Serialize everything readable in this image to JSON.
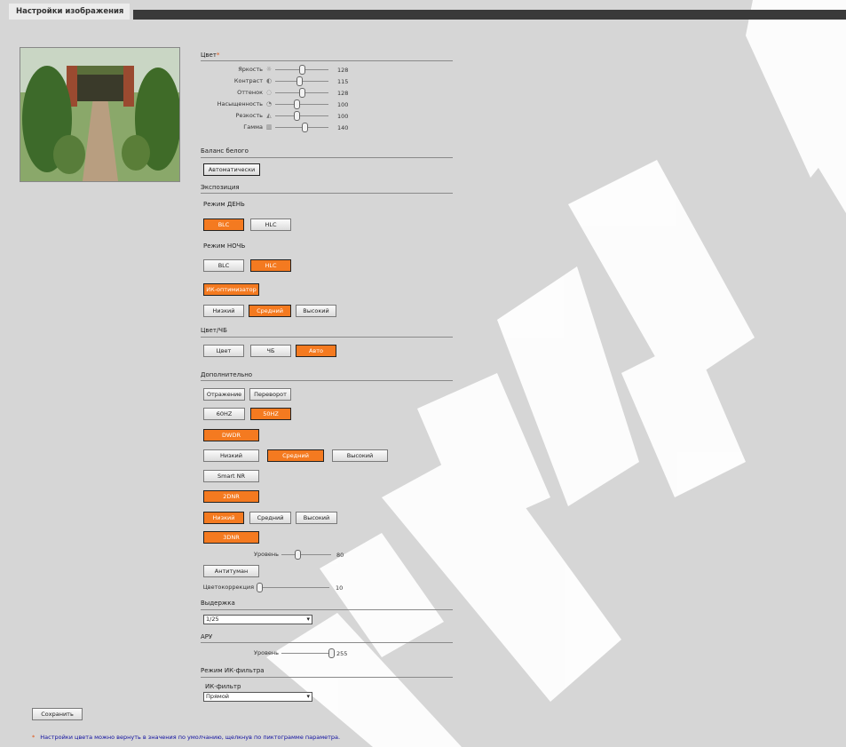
{
  "header": {
    "tab_title": "Настройки изображения"
  },
  "sections": {
    "color": "Цвет",
    "color_star": "*",
    "white_balance": "Баланс белого",
    "exposure": "Экспозиция",
    "color_bw": "Цвет/ЧБ",
    "additional": "Дополнительно",
    "shutter": "Выдержка",
    "agc": "АРУ",
    "ir_filter_mode": "Режим ИК-фильтра"
  },
  "sliders": {
    "brightness": {
      "label": "Яркость",
      "value": "128",
      "icon": "sun-icon",
      "level": 128,
      "max": 255
    },
    "contrast": {
      "label": "Контраст",
      "value": "115",
      "icon": "contrast-icon",
      "level": 115,
      "max": 255
    },
    "hue": {
      "label": "Оттенок",
      "value": "128",
      "icon": "hue-icon",
      "level": 128,
      "max": 255
    },
    "saturation": {
      "label": "Насыщенность",
      "value": "100",
      "icon": "saturation-icon",
      "level": 100,
      "max": 255
    },
    "sharpness": {
      "label": "Резкость",
      "value": "100",
      "icon": "sharpness-icon",
      "level": 100,
      "max": 255
    },
    "gamma": {
      "label": "Гамма",
      "value": "140",
      "icon": "gamma-icon",
      "level": 140,
      "max": 255
    },
    "dnr_level": {
      "label": "Уровень",
      "value": "80",
      "level": 80,
      "max": 255
    },
    "color_correction": {
      "label": "Цветокоррекция",
      "value": "10",
      "level": 10,
      "max": 255
    },
    "agc_level": {
      "label": "Уровень",
      "value": "255",
      "level": 255,
      "max": 255
    }
  },
  "white_balance": {
    "button": "Автоматически"
  },
  "exposure": {
    "day_label": "Режим ДЕНЬ",
    "day_blc": "BLC",
    "day_hlc": "HLC",
    "night_label": "Режим НОЧЬ",
    "night_blc": "BLC",
    "night_hlc": "HLC",
    "ir_optimizer": "ИК-оптимизатор",
    "ir_low": "Низкий",
    "ir_mid": "Средний",
    "ir_high": "Высокий"
  },
  "color_bw": {
    "color": "Цвет",
    "bw": "ЧБ",
    "auto": "Авто"
  },
  "additional": {
    "mirror": "Отражение",
    "flip": "Переворот",
    "hz60": "60HZ",
    "hz50": "50HZ",
    "dwdr": "DWDR",
    "dwdr_low": "Низкий",
    "dwdr_mid": "Средний",
    "dwdr_high": "Высокий",
    "smart_nr": "Smart NR",
    "dnr2": "2DNR",
    "dnr2_low": "Низкий",
    "dnr2_mid": "Средний",
    "dnr2_high": "Высокий",
    "dnr3": "3DNR",
    "antifog": "Антитуман"
  },
  "shutter": {
    "value": "1/25"
  },
  "ir_filter": {
    "label": "ИК-фильтр",
    "value": "Прямой"
  },
  "save_button": "Сохранить",
  "note": {
    "star": "*",
    "text": "Настройки цвета можно вернуть в значения по умолчанию, щелкнув по пиктограмме параметра."
  },
  "colors": {
    "active": "#f47a20",
    "background": "#d6d6d6",
    "header": "#3a3a3a",
    "note": "#1010a0"
  }
}
